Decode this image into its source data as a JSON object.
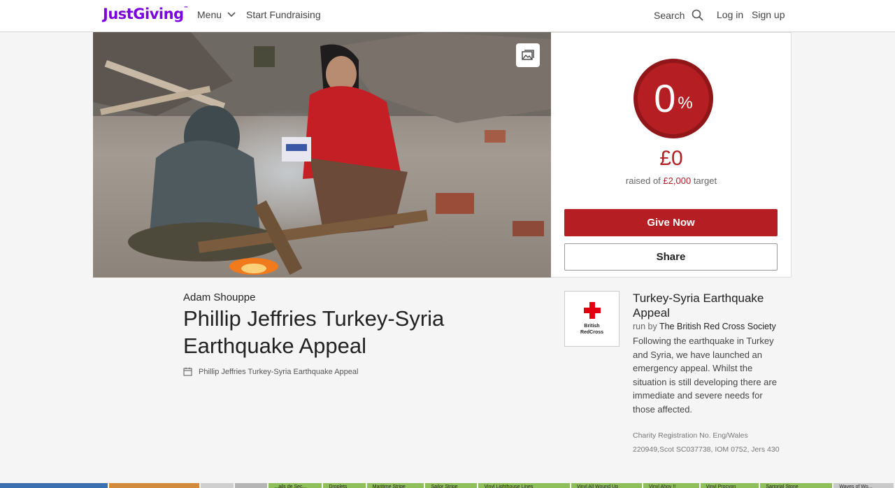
{
  "header": {
    "logo": "JustGiving",
    "logo_tm": "™",
    "menu_label": "Menu",
    "start_label": "Start Fundraising",
    "search_label": "Search",
    "login_label": "Log in",
    "signup_label": "Sign up",
    "brand_color": "#7a04dd"
  },
  "donation": {
    "percent": "0",
    "percent_sign": "%",
    "progress_fraction": 0,
    "raised": "£0",
    "raised_prefix": "raised of",
    "target": "£2,000",
    "raised_suffix": "target",
    "give_label": "Give Now",
    "share_label": "Share",
    "accent_color": "#b51f23"
  },
  "page": {
    "owner": "Adam Shouppe",
    "title": "Phillip Jeffries Turkey-Syria Earthquake Appeal",
    "event_name": "Phillip Jeffries Turkey-Syria Earthquake Appeal"
  },
  "charity": {
    "logo_text_1": "British",
    "logo_text_2": "RedCross",
    "appeal_name": "Turkey-Syria Earthquake Appeal",
    "run_by_prefix": "run by",
    "org_name": "The British Red Cross Society",
    "description": "Following the earthquake in Turkey and Syria, we have launched an emergency appeal. Whilst the situation is still developing there are immediate and severe needs for those affected.",
    "registration": "Charity Registration No. Eng/Wales 220949,Scot SC037738, IOM 0752, Jers 430"
  },
  "bottom_strip": [
    {
      "label": "",
      "color": "#3a6fb0"
    },
    {
      "label": "",
      "color": "#d28a3c"
    },
    {
      "label": "",
      "color": "#cfcfcf"
    },
    {
      "label": "",
      "color": "#b5b5b5"
    },
    {
      "label": "...ails de Sec...",
      "color": "#8fbf5a"
    },
    {
      "label": "Droplets",
      "color": "#8fbf5a"
    },
    {
      "label": "Maritime Stripe",
      "color": "#8fbf5a"
    },
    {
      "label": "Sailor Stripe",
      "color": "#8fbf5a"
    },
    {
      "label": "Vinyl Lighthouse Lines",
      "color": "#8fbf5a"
    },
    {
      "label": "Vinyl All Wound Up",
      "color": "#8fbf5a"
    },
    {
      "label": "Vinyl Ahoy !!",
      "color": "#8fbf5a"
    },
    {
      "label": "Vinyl Procyon",
      "color": "#8fbf5a"
    },
    {
      "label": "Sartorial Stone",
      "color": "#8fbf5a"
    },
    {
      "label": "Waves of Wo...",
      "color": "#c9c9c9"
    }
  ]
}
